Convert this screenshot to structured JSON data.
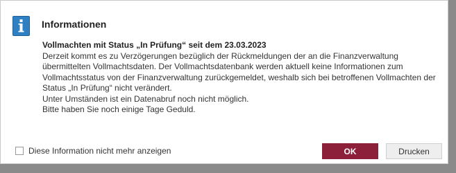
{
  "dialog": {
    "title": "Informationen",
    "icon": "info-icon",
    "message": {
      "heading": "Vollmachten mit Status „In Prüfung“ seit dem 23.03.2023",
      "lines": [
        "Derzeit kommt es zu Verzögerungen bezüglich der Rückmeldungen der an die Finanzverwaltung",
        "übermittelten Vollmachtsdaten. Der Vollmachtsdatenbank werden aktuell keine Informationen zum",
        "Vollmachtsstatus von der Finanzverwaltung zurückgemeldet, weshalb sich bei betroffenen Vollmachten der",
        "Status „In Prüfung“ nicht verändert.",
        "Unter Umständen ist ein Datenabruf noch nicht möglich.",
        "Bitte haben Sie noch einige Tage Geduld."
      ]
    },
    "checkbox": {
      "label": "Diese Information nicht mehr anzeigen",
      "checked": false
    },
    "buttons": {
      "ok": "OK",
      "print": "Drucken"
    }
  },
  "colors": {
    "accent": "#8c1f3a",
    "icon_blue": "#2f7fc3",
    "backdrop": "#8a8a8a"
  }
}
